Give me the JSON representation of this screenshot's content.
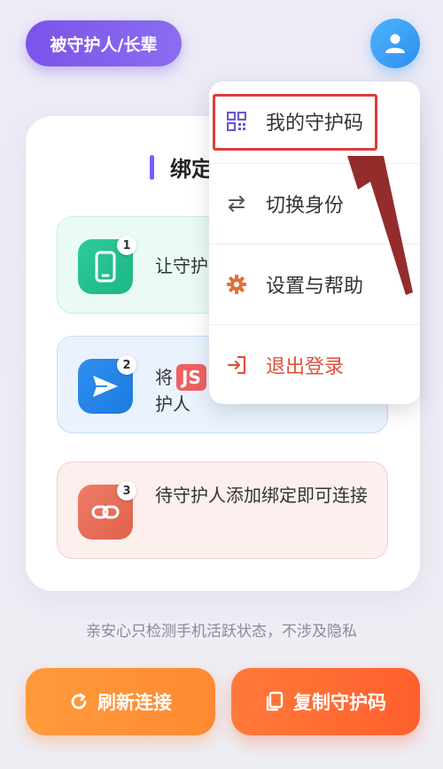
{
  "header": {
    "role_label": "被守护人/长辈"
  },
  "card": {
    "title": "绑定",
    "steps": [
      {
        "number": "1",
        "text": "让守护"
      },
      {
        "number": "2",
        "text_before": "将",
        "tag": "JS",
        "text_after": "护人"
      },
      {
        "number": "3",
        "text": "待守护人添加绑定即可连接"
      }
    ]
  },
  "menu": {
    "items": [
      {
        "label": "我的守护码",
        "icon": "qr-code-icon"
      },
      {
        "label": "切换身份",
        "icon": "swap-arrows-icon"
      },
      {
        "label": "设置与帮助",
        "icon": "gear-icon"
      },
      {
        "label": "退出登录",
        "icon": "logout-icon"
      }
    ]
  },
  "privacy_note": "亲安心只检测手机活跃状态，不涉及隐私",
  "buttons": {
    "refresh_label": "刷新连接",
    "copy_label": "复制守护码"
  },
  "colors": {
    "primary_purple": "#7b53ea",
    "accent_blue": "#2f8ef0",
    "orange": "#ff8a32",
    "highlight_red": "#e03a3a",
    "logout_red": "#e0503c"
  }
}
